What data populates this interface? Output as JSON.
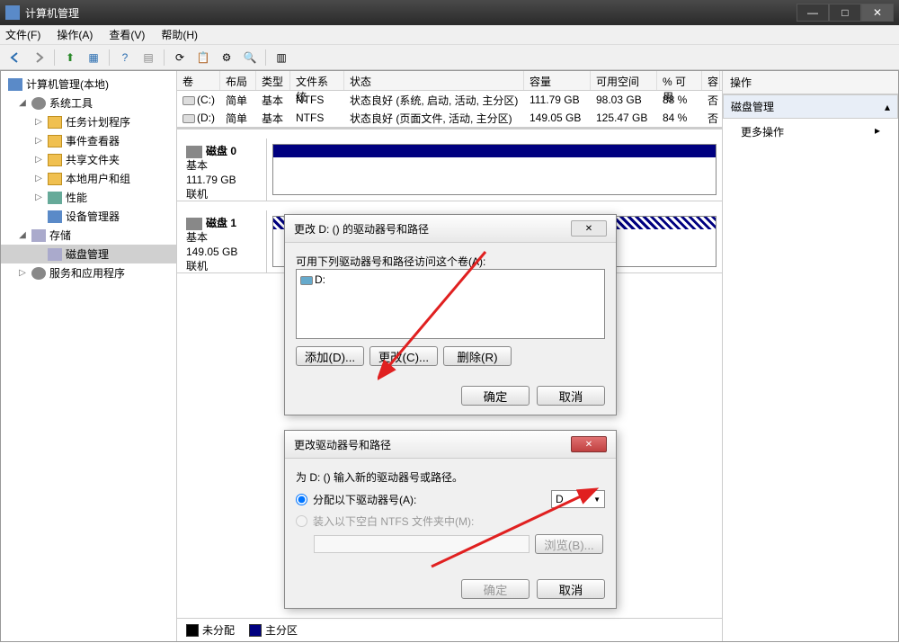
{
  "window": {
    "title": "计算机管理",
    "menu": {
      "file": "文件(F)",
      "action": "操作(A)",
      "view": "查看(V)",
      "help": "帮助(H)"
    }
  },
  "tree": {
    "root": "计算机管理(本地)",
    "systools": "系统工具",
    "scheduler": "任务计划程序",
    "eventviewer": "事件查看器",
    "shared": "共享文件夹",
    "users": "本地用户和组",
    "perf": "性能",
    "devmgr": "设备管理器",
    "storage": "存储",
    "diskmgmt": "磁盘管理",
    "services": "服务和应用程序"
  },
  "volumes": {
    "headers": {
      "vol": "卷",
      "layout": "布局",
      "type": "类型",
      "fs": "文件系统",
      "status": "状态",
      "cap": "容量",
      "free": "可用空间",
      "pct": "% 可用",
      "fault": "容"
    },
    "rows": [
      {
        "vol": "(C:)",
        "layout": "简单",
        "type": "基本",
        "fs": "NTFS",
        "status": "状态良好 (系统, 启动, 活动, 主分区)",
        "cap": "111.79 GB",
        "free": "98.03 GB",
        "pct": "88 %",
        "fault": "否"
      },
      {
        "vol": "(D:)",
        "layout": "简单",
        "type": "基本",
        "fs": "NTFS",
        "status": "状态良好 (页面文件, 活动, 主分区)",
        "cap": "149.05 GB",
        "free": "125.47 GB",
        "pct": "84 %",
        "fault": "否"
      }
    ]
  },
  "disks": [
    {
      "name": "磁盘 0",
      "type": "基本",
      "size": "111.79 GB",
      "status": "联机"
    },
    {
      "name": "磁盘 1",
      "type": "基本",
      "size": "149.05 GB",
      "status": "联机"
    }
  ],
  "legend": {
    "unalloc": "未分配",
    "primary": "主分区"
  },
  "actions": {
    "header": "操作",
    "section": "磁盘管理",
    "more": "更多操作"
  },
  "dialog1": {
    "title": "更改 D: () 的驱动器号和路径",
    "desc": "可用下列驱动器号和路径访问这个卷(A):",
    "entry": "D:",
    "add": "添加(D)...",
    "change": "更改(C)...",
    "remove": "删除(R)",
    "ok": "确定",
    "cancel": "取消"
  },
  "dialog2": {
    "title": "更改驱动器号和路径",
    "desc": "为 D: () 输入新的驱动器号或路径。",
    "assign": "分配以下驱动器号(A):",
    "mount": "装入以下空白 NTFS 文件夹中(M):",
    "letter": "D",
    "browse": "浏览(B)...",
    "ok": "确定",
    "cancel": "取消"
  }
}
